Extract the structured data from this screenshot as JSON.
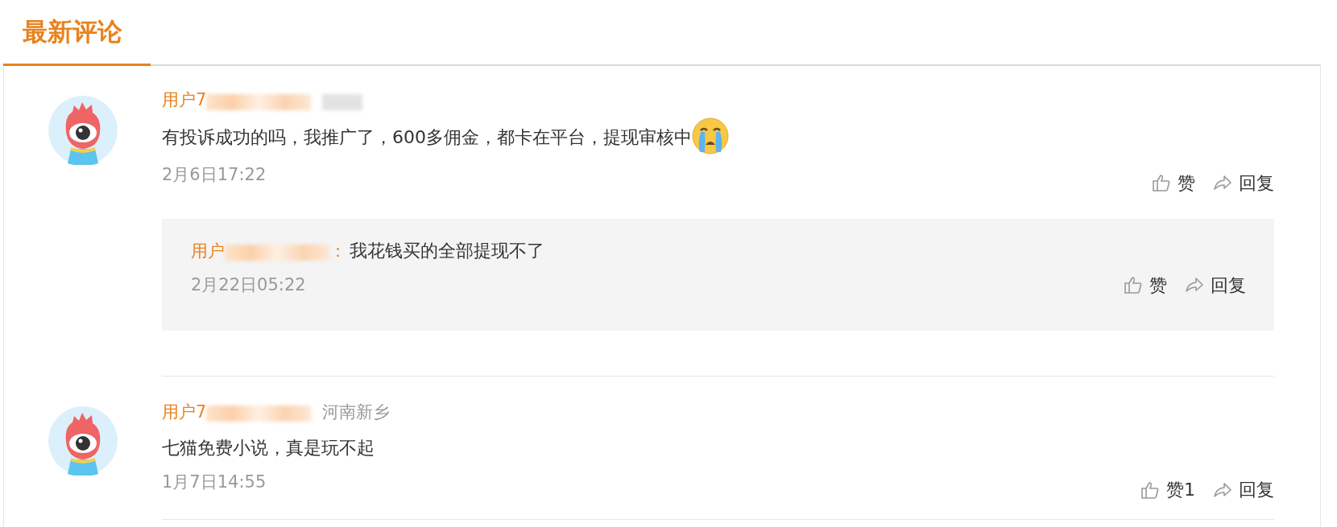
{
  "section_title": "最新评论",
  "comments": [
    {
      "user": "用户7",
      "location_blurred": true,
      "text": "有投诉成功的吗，我推广了，600多佣金，都卡在平台，提现审核中",
      "trailing_emoji": true,
      "time": "2月6日17:22",
      "like_label": "赞",
      "reply_label": "回复",
      "replies": [
        {
          "user": "用户",
          "separator": "：",
          "text": "我花钱买的全部提现不了",
          "time": "2月22日05:22",
          "like_label": "赞",
          "reply_label": "回复"
        }
      ]
    },
    {
      "user": "用户7",
      "location": "河南新乡",
      "text": "七猫免费小说，真是玩不起",
      "time": "1月7日14:55",
      "like_label": "赞1",
      "reply_label": "回复"
    }
  ]
}
